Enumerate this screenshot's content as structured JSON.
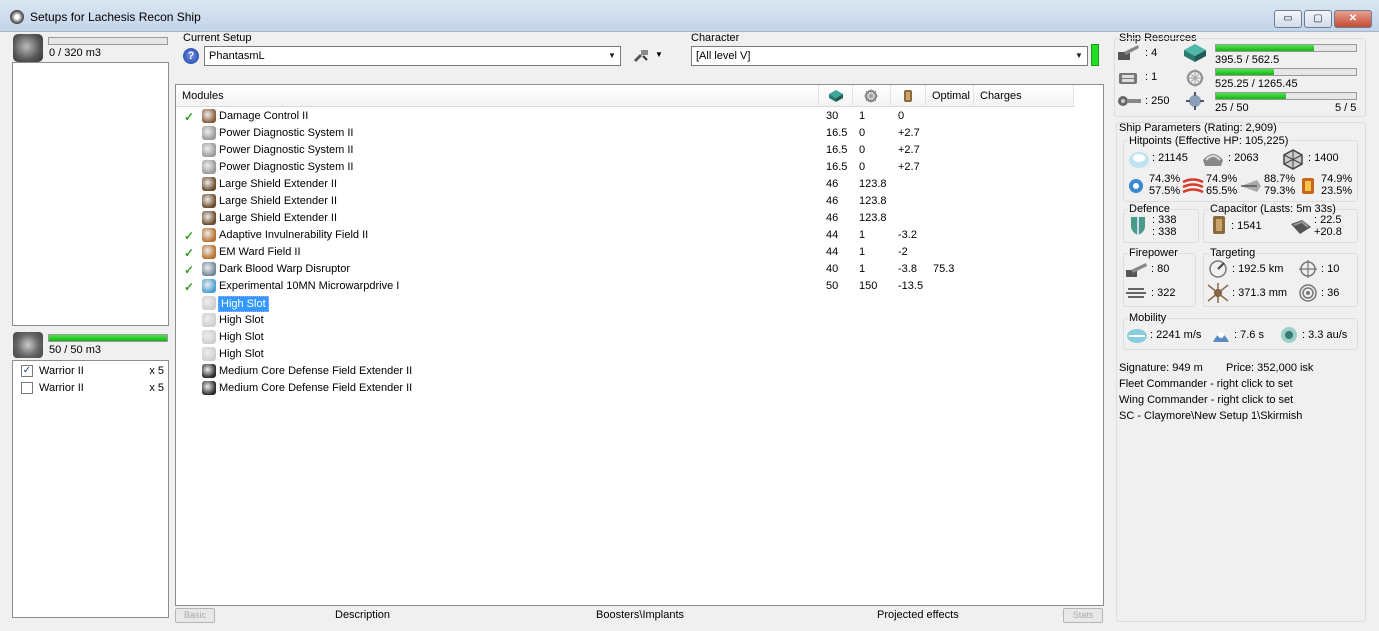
{
  "window": {
    "title": "Setups for Lachesis Recon Ship",
    "min_glyph": "▭",
    "max_glyph": "▢",
    "close_glyph": "✕"
  },
  "cargo": {
    "used_text": "0 / 320 m3",
    "fill": 0.0
  },
  "drones": {
    "bay_text": "50 / 50 m3",
    "fill": 1.0,
    "items": [
      {
        "name": "Warrior II",
        "qty": "x 5",
        "checked": "✓"
      },
      {
        "name": "Warrior II",
        "qty": "x 5",
        "checked": ""
      }
    ]
  },
  "setup": {
    "label": "Current Setup",
    "value": "PhantasmL",
    "help": "?"
  },
  "character": {
    "label": "Character",
    "value": "[All level V]"
  },
  "modules": {
    "headers": {
      "name": "Modules",
      "optimal": "Optimal",
      "charges": "Charges"
    },
    "rows": [
      {
        "check": "✓",
        "icon": "damage-control-icon",
        "color": "#8a5a3a",
        "name": "Damage Control II",
        "c1": "30",
        "c2": "1",
        "c3": "0",
        "c4": ""
      },
      {
        "check": "",
        "icon": "power-diagnostic-icon",
        "color": "#9a9a9a",
        "name": "Power Diagnostic System II",
        "c1": "16.5",
        "c2": "0",
        "c3": "+2.7",
        "c4": ""
      },
      {
        "check": "",
        "icon": "power-diagnostic-icon",
        "color": "#9a9a9a",
        "name": "Power Diagnostic System II",
        "c1": "16.5",
        "c2": "0",
        "c3": "+2.7",
        "c4": ""
      },
      {
        "check": "",
        "icon": "power-diagnostic-icon",
        "color": "#9a9a9a",
        "name": "Power Diagnostic System II",
        "c1": "16.5",
        "c2": "0",
        "c3": "+2.7",
        "c4": ""
      },
      {
        "check": "",
        "icon": "shield-extender-icon",
        "color": "#6b4a2a",
        "name": "Large Shield Extender II",
        "c1": "46",
        "c2": "123.8",
        "c3": "",
        "c4": ""
      },
      {
        "check": "",
        "icon": "shield-extender-icon",
        "color": "#6b4a2a",
        "name": "Large Shield Extender II",
        "c1": "46",
        "c2": "123.8",
        "c3": "",
        "c4": ""
      },
      {
        "check": "",
        "icon": "shield-extender-icon",
        "color": "#6b4a2a",
        "name": "Large Shield Extender II",
        "c1": "46",
        "c2": "123.8",
        "c3": "",
        "c4": ""
      },
      {
        "check": "✓",
        "icon": "invulnerability-field-icon",
        "color": "#b8702e",
        "name": "Adaptive Invulnerability Field II",
        "c1": "44",
        "c2": "1",
        "c3": "-3.2",
        "c4": ""
      },
      {
        "check": "✓",
        "icon": "ward-field-icon",
        "color": "#b8702e",
        "name": "EM Ward Field II",
        "c1": "44",
        "c2": "1",
        "c3": "-2",
        "c4": ""
      },
      {
        "check": "✓",
        "icon": "warp-disruptor-icon",
        "color": "#6f8a9a",
        "name": "Dark Blood Warp Disruptor",
        "c1": "40",
        "c2": "1",
        "c3": "-3.8",
        "c4": "75.3"
      },
      {
        "check": "✓",
        "icon": "microwarpdrive-icon",
        "color": "#4a9fd0",
        "name": "Experimental 10MN Microwarpdrive I",
        "c1": "50",
        "c2": "150",
        "c3": "-13.5",
        "c4": ""
      },
      {
        "check": "",
        "icon": "high-slot-icon",
        "color": "#cfcfcf",
        "name": "High Slot",
        "c1": "",
        "c2": "",
        "c3": "",
        "c4": "",
        "selected": true
      },
      {
        "check": "",
        "icon": "high-slot-icon",
        "color": "#cfcfcf",
        "name": "High Slot",
        "c1": "",
        "c2": "",
        "c3": "",
        "c4": ""
      },
      {
        "check": "",
        "icon": "high-slot-icon",
        "color": "#cfcfcf",
        "name": "High Slot",
        "c1": "",
        "c2": "",
        "c3": "",
        "c4": ""
      },
      {
        "check": "",
        "icon": "high-slot-icon",
        "color": "#cfcfcf",
        "name": "High Slot",
        "c1": "",
        "c2": "",
        "c3": "",
        "c4": ""
      },
      {
        "check": "",
        "icon": "rig-icon",
        "color": "#2a2a2a",
        "name": "Medium Core Defense Field Extender II",
        "c1": "",
        "c2": "",
        "c3": "",
        "c4": ""
      },
      {
        "check": "",
        "icon": "rig-icon",
        "color": "#2a2a2a",
        "name": "Medium Core Defense Field Extender II",
        "c1": "",
        "c2": "",
        "c3": "",
        "c4": ""
      }
    ]
  },
  "bottom_tabs": {
    "left_button": "Basic",
    "description": "Description",
    "boosters": "Boosters\\Implants",
    "projected": "Projected effects",
    "right_button": "Stats"
  },
  "resources": {
    "label": "Ship Resources",
    "turret_slots": "4",
    "launcher_slots": "1",
    "drone_bandwidth": "250",
    "cpu_text": "395.5 / 562.5",
    "cpu_fill": 0.703,
    "pg_text": "525.25 / 1265.45",
    "pg_fill": 0.415,
    "calibration_text": "25 / 50",
    "calibration_fill": 0.5,
    "rig_slots_text": "5 / 5"
  },
  "params": {
    "label": "Ship Parameters (Rating: 2,909)",
    "hitpoints": {
      "label": "Hitpoints (Effective HP: 105,225)",
      "shield": "21145",
      "armor": "2063",
      "structure": "1400",
      "em": [
        "74.3%",
        "57.5%"
      ],
      "thermal": [
        "74.9%",
        "65.5%"
      ],
      "kinetic": [
        "88.7%",
        "79.3%"
      ],
      "explosive": [
        "74.9%",
        "23.5%"
      ]
    },
    "defence": {
      "label": "Defence",
      "v1": "338",
      "v2": "338"
    },
    "capacitor": {
      "label": "Capacitor (Lasts: 5m 33s)",
      "capacity": "1541",
      "recharge_a": "22.5",
      "recharge_b": "+20.8"
    },
    "firepower": {
      "label": "Firepower",
      "dps": "80",
      "volley": "322"
    },
    "targeting": {
      "label": "Targeting",
      "range": "192.5 km",
      "max_targets": "10",
      "scan_res": "371.3 mm",
      "sensor": "36"
    },
    "mobility": {
      "label": "Mobility",
      "speed": "2241 m/s",
      "align": "7.6 s",
      "warp": "3.3 au/s"
    },
    "signature": "Signature: 949 m",
    "price": "Price: 352,000 isk",
    "fleet_commander": "Fleet Commander - right click to set",
    "wing_commander": "Wing Commander - right click to set",
    "sc_path": "SC - Claymore\\New Setup 1\\Skirmish"
  }
}
